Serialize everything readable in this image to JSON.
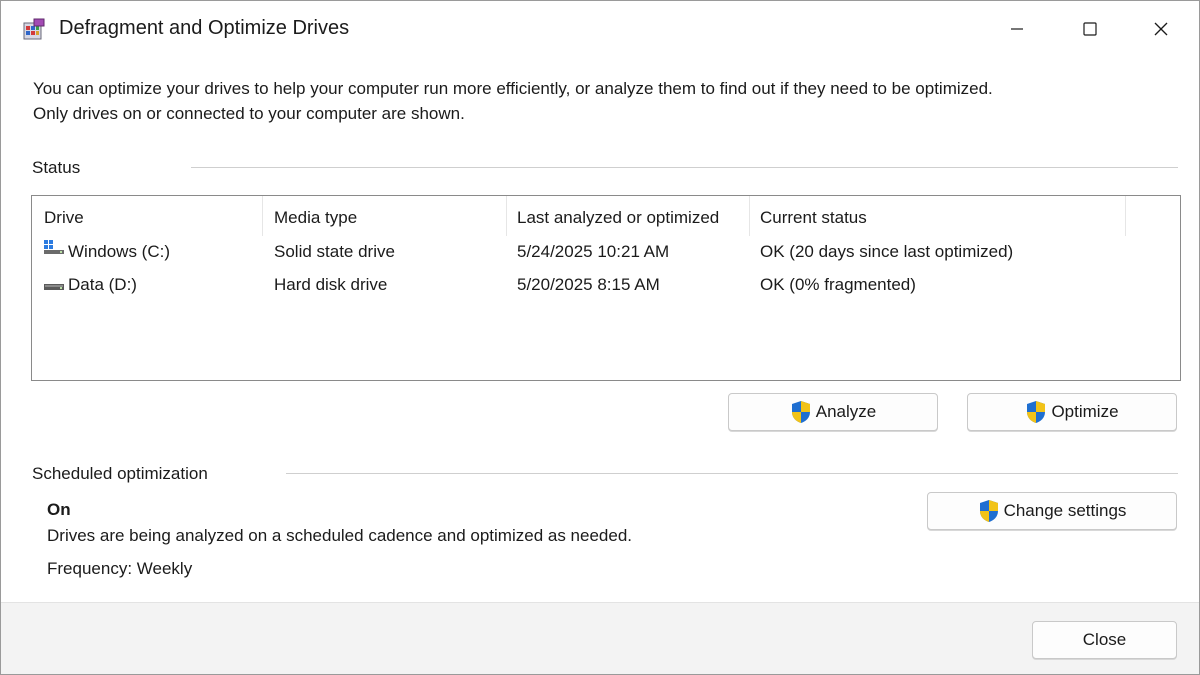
{
  "window": {
    "title": "Defragment and Optimize Drives",
    "app_icon": "defrag-app-icon",
    "controls": {
      "minimize": "minimize-icon",
      "maximize": "maximize-icon",
      "close": "close-icon"
    }
  },
  "description": {
    "line1": "You can optimize your drives to help your computer run more efficiently, or analyze them to find out if they need to be optimized.",
    "line2": "Only drives on or connected to your computer are shown."
  },
  "status": {
    "label": "Status",
    "columns": [
      "Drive",
      "Media type",
      "Last analyzed or optimized",
      "Current status"
    ],
    "rows": [
      {
        "icon": "windows-drive-icon",
        "drive": "Windows (C:)",
        "media": "Solid state drive",
        "last": "5/24/2025 10:21 AM",
        "status": "OK (20 days since last optimized)"
      },
      {
        "icon": "hard-drive-icon",
        "drive": "Data (D:)",
        "media": "Hard disk drive",
        "last": "5/20/2025 8:15 AM",
        "status": "OK (0% fragmented)"
      }
    ]
  },
  "actions": {
    "analyze": "Analyze",
    "optimize": "Optimize"
  },
  "scheduled": {
    "label": "Scheduled optimization",
    "state": "On",
    "description": "Drives are being analyzed on a scheduled cadence and optimized as needed.",
    "frequency": "Frequency: Weekly",
    "change_settings": "Change settings"
  },
  "footer": {
    "close": "Close"
  },
  "colors": {
    "shield_blue": "#1f6fd1",
    "shield_yellow": "#f2c318",
    "border": "#8a8a8a",
    "footer_bg": "#f3f3f3"
  }
}
